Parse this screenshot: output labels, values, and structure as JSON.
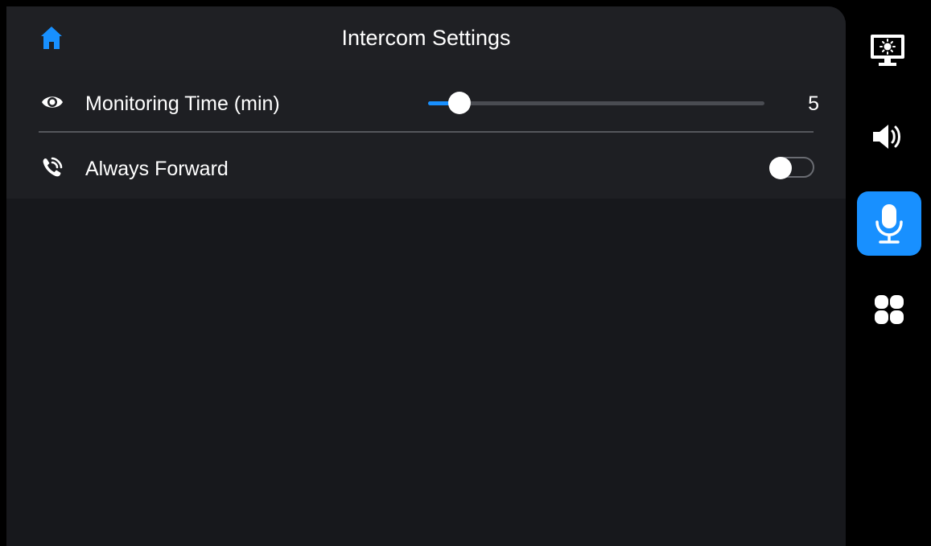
{
  "header": {
    "title": "Intercom Settings",
    "home_icon": "home-icon"
  },
  "settings": [
    {
      "label": "Monitoring Time (min)",
      "icon": "eye-icon",
      "control": "slider",
      "value": "5",
      "slider_fraction": 0.06
    },
    {
      "label": "Always Forward",
      "icon": "phone-forward-icon",
      "control": "toggle",
      "on": false
    }
  ],
  "sidebar": {
    "items": [
      {
        "name": "display",
        "icon": "display-brightness-icon",
        "active": false
      },
      {
        "name": "sound",
        "icon": "speaker-icon",
        "active": false
      },
      {
        "name": "intercom",
        "icon": "microphone-icon",
        "active": true
      },
      {
        "name": "apps",
        "icon": "apps-grid-icon",
        "active": false
      }
    ]
  },
  "colors": {
    "accent": "#1890ff",
    "background": "#000000",
    "panel": "#17181c",
    "header": "#1f2024",
    "rows": "#1e1f23"
  }
}
